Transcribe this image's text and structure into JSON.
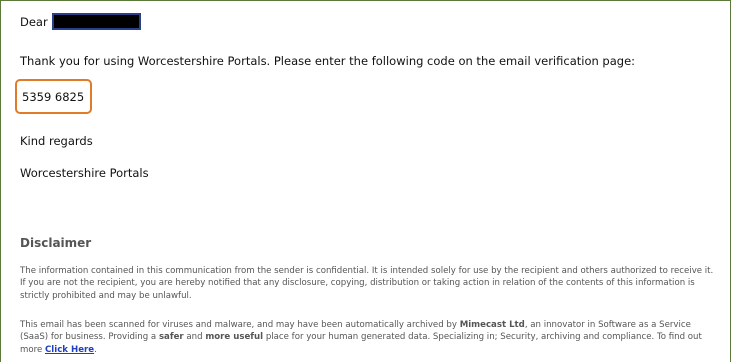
{
  "email": {
    "greeting": "Dear",
    "intro": "Thank you for using Worcestershire Portals. Please enter the following code on the email verification page:",
    "code": "5359 6825",
    "closing": "Kind regards",
    "signature": "Worcestershire Portals"
  },
  "disclaimer": {
    "title": "Disclaimer",
    "paragraph1": "The information contained in this communication from the sender is confidential. It is intended solely for use by the recipient and others authorized to receive it. If you are not the recipient, you are hereby notified that any disclosure, copying, distribution or taking action in relation of the contents of this information is strictly prohibited and may be unlawful.",
    "p2_a": "This email has been scanned for viruses and malware, and may have been automatically archived by ",
    "p2_company": "Mimecast Ltd",
    "p2_b": ", an innovator in Software as a Service (SaaS) for business. Providing a ",
    "p2_safer": "safer",
    "p2_c": " and ",
    "p2_more_useful": "more useful",
    "p2_d": " place for your human generated data. Specializing in; Security, archiving and compliance. To find out more ",
    "p2_link": "Click Here",
    "p2_end": "."
  },
  "colors": {
    "frame_border": "#5a7a3a",
    "code_highlight": "#e07b2a",
    "redaction_border": "#2a3f8a",
    "link": "#1f3fbf"
  }
}
